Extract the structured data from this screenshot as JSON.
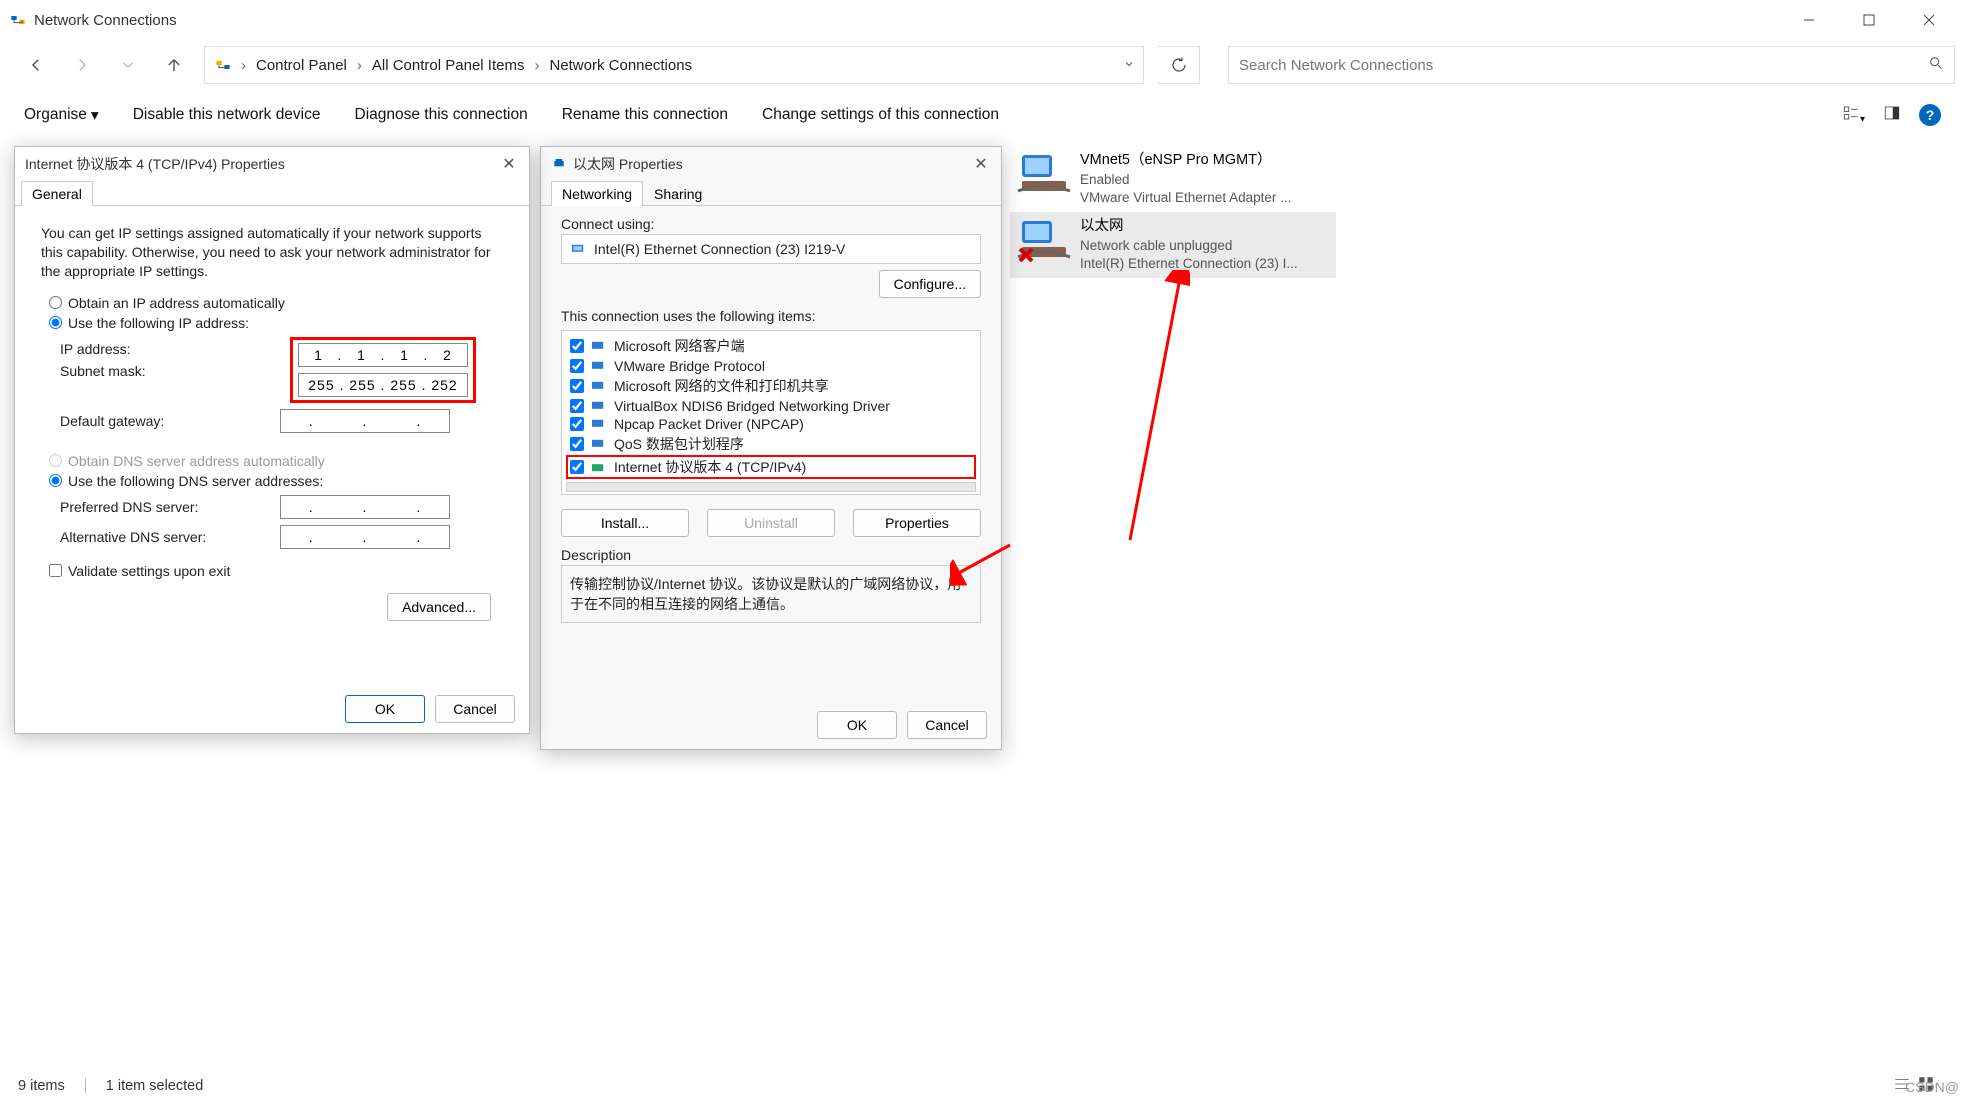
{
  "titlebar": {
    "title": "Network Connections"
  },
  "nav": {
    "crumbs": [
      "Control Panel",
      "All Control Panel Items",
      "Network Connections"
    ],
    "search_placeholder": "Search Network Connections"
  },
  "toolbar": {
    "organise": "Organise",
    "disable": "Disable this network device",
    "diagnose": "Diagnose this connection",
    "rename": "Rename this connection",
    "change_settings": "Change settings of this connection"
  },
  "connections": {
    "item1": {
      "name": "VMnet5（eNSP Pro MGMT）",
      "status": "Enabled",
      "adapter": "VMware Virtual Ethernet Adapter ..."
    },
    "item2": {
      "name": "以太网",
      "status": "Network cable unplugged",
      "adapter": "Intel(R) Ethernet Connection (23) I..."
    }
  },
  "eth_dialog": {
    "title": "以太网 Properties",
    "tab_networking": "Networking",
    "tab_sharing": "Sharing",
    "connect_using_label": "Connect using:",
    "adapter_name": "Intel(R) Ethernet Connection (23) I219-V",
    "configure_btn": "Configure...",
    "items_label": "This connection uses the following items:",
    "items": [
      {
        "checked": true,
        "label": "Microsoft 网络客户端"
      },
      {
        "checked": true,
        "label": "VMware Bridge Protocol"
      },
      {
        "checked": true,
        "label": "Microsoft 网络的文件和打印机共享"
      },
      {
        "checked": true,
        "label": "VirtualBox NDIS6 Bridged Networking Driver"
      },
      {
        "checked": true,
        "label": "Npcap Packet Driver (NPCAP)"
      },
      {
        "checked": true,
        "label": "QoS 数据包计划程序"
      },
      {
        "checked": true,
        "label": "Internet 协议版本 4 (TCP/IPv4)"
      }
    ],
    "install_btn": "Install...",
    "uninstall_btn": "Uninstall",
    "properties_btn": "Properties",
    "description_label": "Description",
    "description_text": "传输控制协议/Internet 协议。该协议是默认的广域网络协议，用于在不同的相互连接的网络上通信。",
    "ok_btn": "OK",
    "cancel_btn": "Cancel"
  },
  "ip_dialog": {
    "title": "Internet 协议版本 4 (TCP/IPv4) Properties",
    "tab_general": "General",
    "desc": "You can get IP settings assigned automatically if your network supports this capability. Otherwise, you need to ask your network administrator for the appropriate IP settings.",
    "radio_auto_ip": "Obtain an IP address automatically",
    "radio_static_ip": "Use the following IP address:",
    "ip_label": "IP address:",
    "ip_value": "1   .   1   .   1   .   2",
    "subnet_label": "Subnet mask:",
    "subnet_value": "255 . 255 . 255 . 252",
    "gateway_label": "Default gateway:",
    "gateway_value": ".          .          .",
    "radio_auto_dns": "Obtain DNS server address automatically",
    "radio_static_dns": "Use the following DNS server addresses:",
    "pref_dns_label": "Preferred DNS server:",
    "pref_dns_value": ".          .          .",
    "alt_dns_label": "Alternative DNS server:",
    "alt_dns_value": ".          .          .",
    "validate_label": "Validate settings upon exit",
    "advanced_btn": "Advanced...",
    "ok_btn": "OK",
    "cancel_btn": "Cancel"
  },
  "statusbar": {
    "items": "9 items",
    "selected": "1 item selected"
  },
  "watermark": "CSDN@"
}
